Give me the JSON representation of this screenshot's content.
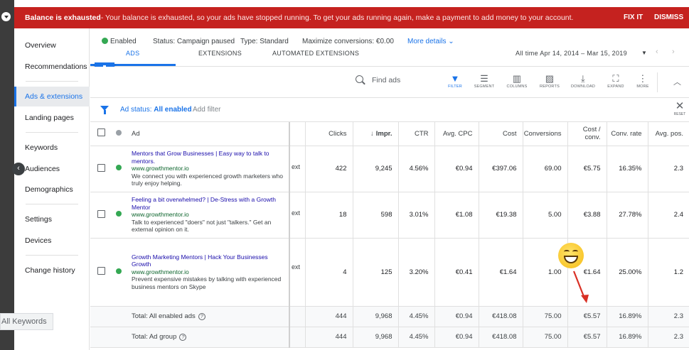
{
  "banner": {
    "strong": "Balance is exhausted",
    "message": " - Your balance is exhausted, so your ads have stopped running. To get your ads running again, make a payment to add money to your account.",
    "fix_it": "FIX IT",
    "dismiss": "DISMISS"
  },
  "sidebar": {
    "items": [
      {
        "label": "Overview"
      },
      {
        "label": "Recommendations"
      },
      {
        "label": "Ads & extensions"
      },
      {
        "label": "Landing pages"
      },
      {
        "label": "Keywords"
      },
      {
        "label": "Audiences"
      },
      {
        "label": "Demographics"
      },
      {
        "label": "Settings"
      },
      {
        "label": "Devices"
      },
      {
        "label": "Change history"
      }
    ],
    "tooltip": "All Keywords"
  },
  "summary": {
    "status": "Enabled",
    "campaign_status": "Status: Campaign paused",
    "type": "Type: Standard",
    "bidding": "Maximize conversions: €0.00",
    "more_details": "More details"
  },
  "tabs": {
    "ads": "ADS",
    "extensions": "EXTENSIONS",
    "automated": "AUTOMATED EXTENSIONS",
    "date_range": "All time  Apr 14, 2014 – Mar 15, 2019"
  },
  "toolbar": {
    "find_placeholder": "Find ads",
    "filter": "FILTER",
    "segment": "SEGMENT",
    "columns": "COLUMNS",
    "reports": "REPORTS",
    "download": "DOWNLOAD",
    "expand": "EXPAND",
    "more": "MORE"
  },
  "filter_row": {
    "status_prefix": "Ad status: ",
    "status_value": "All enabled",
    "add_filter": "Add filter",
    "reset": "RESET"
  },
  "table": {
    "headers": {
      "ad": "Ad",
      "clicks": "Clicks",
      "impr": "Impr.",
      "ctr": "CTR",
      "avg_cpc": "Avg. CPC",
      "cost": "Cost",
      "conversions": "Conversions",
      "cost_conv_1": "Cost /",
      "cost_conv_2": "conv.",
      "conv_rate": "Conv. rate",
      "avg_pos": "Avg. pos."
    },
    "rows": [
      {
        "headline": "Mentors that Grow Businesses | Easy way to talk to mentors.",
        "url": "www.growthmentor.io",
        "description": "We connect you with experienced growth marketers who truly enjoy helping.",
        "type_fragment": "ext",
        "clicks": "422",
        "impr": "9,245",
        "ctr": "4.56%",
        "avg_cpc": "€0.94",
        "cost": "€397.06",
        "conversions": "69.00",
        "cost_conv": "€5.75",
        "conv_rate": "16.35%",
        "avg_pos": "2.3"
      },
      {
        "headline": "Feeling a bit overwhelmed? | De-Stress with a Growth Mentor",
        "url": "www.growthmentor.io",
        "description": "Talk to experienced \"doers\" not just \"talkers.\" Get an external opinion on it.",
        "type_fragment": "ext",
        "clicks": "18",
        "impr": "598",
        "ctr": "3.01%",
        "avg_cpc": "€1.08",
        "cost": "€19.38",
        "conversions": "5.00",
        "cost_conv": "€3.88",
        "conv_rate": "27.78%",
        "avg_pos": "2.4"
      },
      {
        "headline": "Growth Marketing Mentors | Hack Your Businesses Growth",
        "url": "www.growthmentor.io",
        "description": "Prevent expensive mistakes by talking with experienced business mentors on Skype",
        "type_fragment": "ext",
        "clicks": "4",
        "impr": "125",
        "ctr": "3.20%",
        "avg_cpc": "€0.41",
        "cost": "€1.64",
        "conversions": "1.00",
        "cost_conv": "€1.64",
        "conv_rate": "25.00%",
        "avg_pos": "1.2"
      }
    ],
    "totals": [
      {
        "label": "Total: All enabled ads",
        "clicks": "444",
        "impr": "9,968",
        "ctr": "4.45%",
        "avg_cpc": "€0.94",
        "cost": "€418.08",
        "conversions": "75.00",
        "cost_conv": "€5.57",
        "conv_rate": "16.89%",
        "avg_pos": "2.3"
      },
      {
        "label": "Total: Ad group",
        "clicks": "444",
        "impr": "9,968",
        "ctr": "4.45%",
        "avg_cpc": "€0.94",
        "cost": "€418.08",
        "conversions": "75.00",
        "cost_conv": "€5.57",
        "conv_rate": "16.89%",
        "avg_pos": "2.3"
      }
    ]
  },
  "colors": {
    "banner_red": "#c5221f",
    "accent_blue": "#1a73e8",
    "enabled_green": "#34a853",
    "annotation_arrow": "#d93025"
  },
  "icons": [
    "search-icon",
    "filter-icon",
    "segment-icon",
    "columns-icon",
    "reports-icon",
    "download-icon",
    "expand-icon",
    "more-icon",
    "chevron-up-icon",
    "close-icon",
    "chevron-down-icon",
    "grinning-emoji"
  ]
}
